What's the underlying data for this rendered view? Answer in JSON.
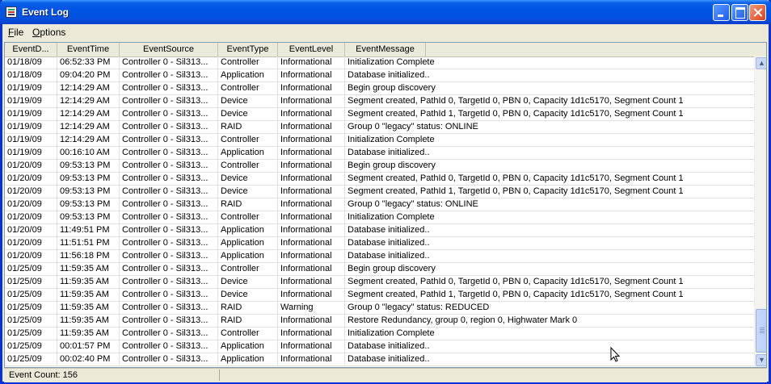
{
  "window": {
    "title": "Event Log"
  },
  "menu": [
    {
      "u": "F",
      "rest": "ile"
    },
    {
      "u": "O",
      "rest": "ptions"
    }
  ],
  "columns": [
    "EventD...",
    "EventTime",
    "EventSource",
    "EventType",
    "EventLevel",
    "EventMessage"
  ],
  "rows": [
    [
      "01/18/09",
      "06:52:33 PM",
      "Controller 0 - Sil313...",
      "Controller",
      "Informational",
      "Initialization Complete"
    ],
    [
      "01/18/09",
      "09:04:20 PM",
      "Controller 0 - Sil313...",
      "Application",
      "Informational",
      "Database initialized.."
    ],
    [
      "01/19/09",
      "12:14:29 AM",
      "Controller 0 - Sil313...",
      "Controller",
      "Informational",
      "Begin group discovery"
    ],
    [
      "01/19/09",
      "12:14:29 AM",
      "Controller 0 - Sil313...",
      "Device",
      "Informational",
      "Segment created, PathId 0, TargetId 0, PBN 0, Capacity 1d1c5170, Segment Count 1"
    ],
    [
      "01/19/09",
      "12:14:29 AM",
      "Controller 0 - Sil313...",
      "Device",
      "Informational",
      "Segment created, PathId 1, TargetId 0, PBN 0, Capacity 1d1c5170, Segment Count 1"
    ],
    [
      "01/19/09",
      "12:14:29 AM",
      "Controller 0 - Sil313...",
      "RAID",
      "Informational",
      "Group 0 \"legacy\" status: ONLINE"
    ],
    [
      "01/19/09",
      "12:14:29 AM",
      "Controller 0 - Sil313...",
      "Controller",
      "Informational",
      "Initialization Complete"
    ],
    [
      "01/19/09",
      "00:16:10 AM",
      "Controller 0 - Sil313...",
      "Application",
      "Informational",
      "Database initialized.."
    ],
    [
      "01/20/09",
      "09:53:13 PM",
      "Controller 0 - Sil313...",
      "Controller",
      "Informational",
      "Begin group discovery"
    ],
    [
      "01/20/09",
      "09:53:13 PM",
      "Controller 0 - Sil313...",
      "Device",
      "Informational",
      "Segment created, PathId 0, TargetId 0, PBN 0, Capacity 1d1c5170, Segment Count 1"
    ],
    [
      "01/20/09",
      "09:53:13 PM",
      "Controller 0 - Sil313...",
      "Device",
      "Informational",
      "Segment created, PathId 1, TargetId 0, PBN 0, Capacity 1d1c5170, Segment Count 1"
    ],
    [
      "01/20/09",
      "09:53:13 PM",
      "Controller 0 - Sil313...",
      "RAID",
      "Informational",
      "Group 0 \"legacy\" status: ONLINE"
    ],
    [
      "01/20/09",
      "09:53:13 PM",
      "Controller 0 - Sil313...",
      "Controller",
      "Informational",
      "Initialization Complete"
    ],
    [
      "01/20/09",
      "11:49:51 PM",
      "Controller 0 - Sil313...",
      "Application",
      "Informational",
      "Database initialized.."
    ],
    [
      "01/20/09",
      "11:51:51 PM",
      "Controller 0 - Sil313...",
      "Application",
      "Informational",
      "Database initialized.."
    ],
    [
      "01/20/09",
      "11:56:18 PM",
      "Controller 0 - Sil313...",
      "Application",
      "Informational",
      "Database initialized.."
    ],
    [
      "01/25/09",
      "11:59:35 AM",
      "Controller 0 - Sil313...",
      "Controller",
      "Informational",
      "Begin group discovery"
    ],
    [
      "01/25/09",
      "11:59:35 AM",
      "Controller 0 - Sil313...",
      "Device",
      "Informational",
      "Segment created, PathId 0, TargetId 0, PBN 0, Capacity 1d1c5170, Segment Count 1"
    ],
    [
      "01/25/09",
      "11:59:35 AM",
      "Controller 0 - Sil313...",
      "Device",
      "Informational",
      "Segment created, PathId 1, TargetId 0, PBN 0, Capacity 1d1c5170, Segment Count 1"
    ],
    [
      "01/25/09",
      "11:59:35 AM",
      "Controller 0 - Sil313...",
      "RAID",
      "Warning",
      "Group 0 \"legacy\" status: REDUCED"
    ],
    [
      "01/25/09",
      "11:59:35 AM",
      "Controller 0 - Sil313...",
      "RAID",
      "Informational",
      "Restore Redundancy, group 0, region 0, Highwater Mark 0"
    ],
    [
      "01/25/09",
      "11:59:35 AM",
      "Controller 0 - Sil313...",
      "Controller",
      "Informational",
      "Initialization Complete"
    ],
    [
      "01/25/09",
      "00:01:57 PM",
      "Controller 0 - Sil313...",
      "Application",
      "Informational",
      "Database initialized.."
    ],
    [
      "01/25/09",
      "00:02:40 PM",
      "Controller 0 - Sil313...",
      "Application",
      "Informational",
      "Database initialized.."
    ]
  ],
  "scroll_position": 0.95,
  "status": {
    "text": "Event Count: 156"
  },
  "colors": {
    "titlebar": "#0054e3",
    "window_bg": "#ece9d8",
    "list_border": "#7f9db9"
  }
}
